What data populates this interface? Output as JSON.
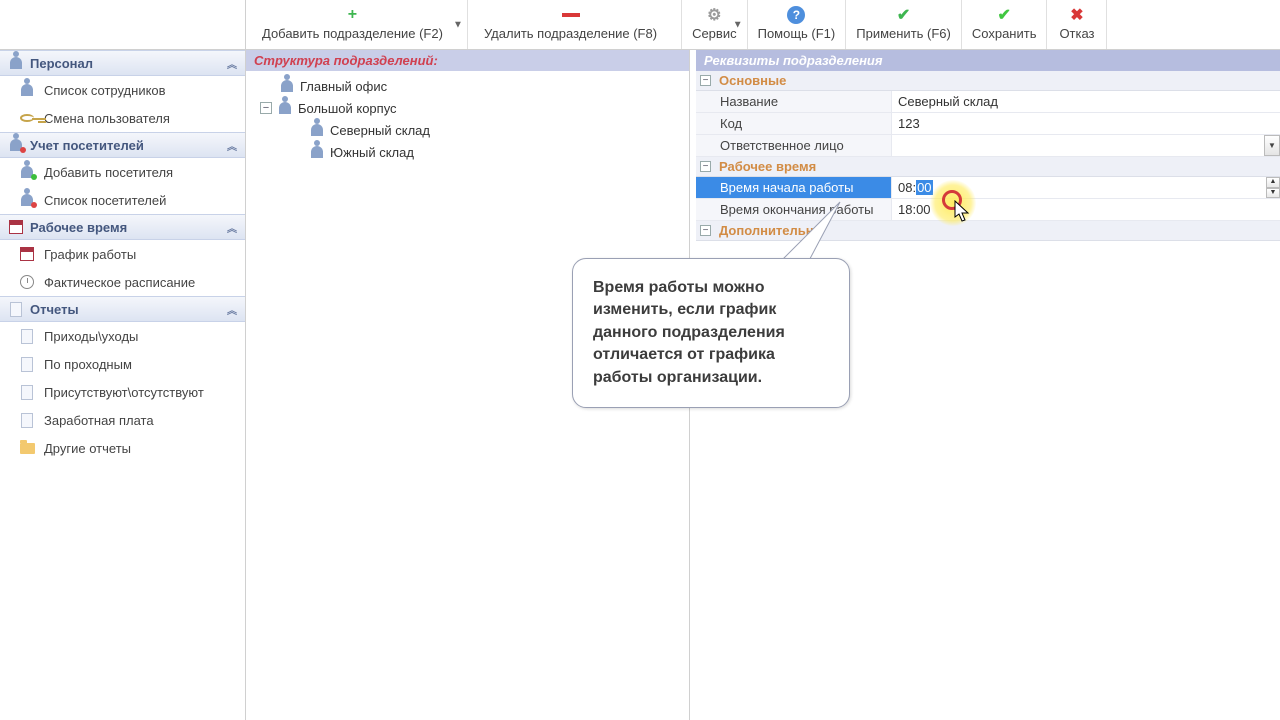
{
  "toolbar": {
    "add": "Добавить подразделение (F2)",
    "delete": "Удалить подразделение (F8)",
    "service": "Сервис",
    "help": "Помощь (F1)",
    "apply": "Применить (F6)",
    "save": "Сохранить",
    "cancel": "Отказ"
  },
  "sidebar": {
    "sections": [
      {
        "title": "Персонал",
        "items": [
          "Список сотрудников",
          "Смена пользователя"
        ]
      },
      {
        "title": "Учет посетителей",
        "items": [
          "Добавить посетителя",
          "Список посетителей"
        ]
      },
      {
        "title": "Рабочее время",
        "items": [
          "График работы",
          "Фактическое расписание"
        ]
      },
      {
        "title": "Отчеты",
        "items": [
          "Приходы\\уходы",
          "По проходным",
          "Присутствуют\\отсутствуют",
          "Заработная плата",
          "Другие отчеты"
        ]
      }
    ]
  },
  "treePanel": {
    "title": "Структура подразделений:",
    "root": "Главный офис",
    "group": "Большой корпус",
    "children": [
      "Северный склад",
      "Южный склад"
    ]
  },
  "propPanel": {
    "title": "Реквизиты подразделения",
    "group1": "Основные",
    "nameLabel": "Название",
    "nameVal": "Северный склад",
    "codeLabel": "Код",
    "codeVal": "123",
    "respLabel": "Ответственное лицо",
    "respVal": "",
    "group2": "Рабочее время",
    "startLabel": "Время начала работы",
    "startHH": "08:",
    "startMM": "00",
    "endLabel": "Время окончания работы",
    "endVal": "18:00",
    "group3": "Дополнительно"
  },
  "callout": "Время работы можно изменить, если график данного подразделения отличается от графика работы организации."
}
